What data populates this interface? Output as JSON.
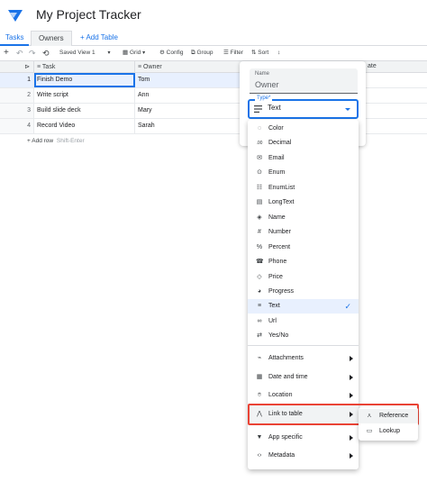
{
  "app": {
    "title": "My Project Tracker",
    "accent": "#1a73e8"
  },
  "tabs": [
    {
      "label": "Tasks"
    },
    {
      "label": "Owners"
    },
    {
      "label": "+ Add Table"
    }
  ],
  "toolbar": {
    "saved_view": "Saved View 1",
    "grid": "Grid",
    "config": "Config",
    "group": "Group",
    "filter": "Filter",
    "sort": "Sort"
  },
  "grid": {
    "columns": [
      "Task",
      "Owner"
    ],
    "rows": [
      {
        "num": "1",
        "task": "Finish Demo",
        "owner": "Tom"
      },
      {
        "num": "2",
        "task": "Write script",
        "owner": "Ann"
      },
      {
        "num": "3",
        "task": "Build slide deck",
        "owner": "Mary"
      },
      {
        "num": "4",
        "task": "Record Video",
        "owner": "Sarah"
      }
    ],
    "add_row": "Add row",
    "add_row_hint": "Shift-Enter",
    "partial_column": "ate"
  },
  "column_editor": {
    "name_label": "Name",
    "name_value": "Owner",
    "type_label": "Type*",
    "type_value": "Text"
  },
  "type_menu": {
    "items": [
      {
        "label": "Color",
        "icon": "palette-icon"
      },
      {
        "label": "Decimal",
        "icon": "decimal-icon"
      },
      {
        "label": "Email",
        "icon": "email-icon"
      },
      {
        "label": "Enum",
        "icon": "enum-icon"
      },
      {
        "label": "EnumList",
        "icon": "enum-list-icon"
      },
      {
        "label": "LongText",
        "icon": "long-text-icon"
      },
      {
        "label": "Name",
        "icon": "name-icon"
      },
      {
        "label": "Number",
        "icon": "number-icon"
      },
      {
        "label": "Percent",
        "icon": "percent-icon"
      },
      {
        "label": "Phone",
        "icon": "phone-icon"
      },
      {
        "label": "Price",
        "icon": "price-icon"
      },
      {
        "label": "Progress",
        "icon": "progress-icon"
      },
      {
        "label": "Text",
        "icon": "text-icon",
        "selected": true
      },
      {
        "label": "Url",
        "icon": "link-icon"
      },
      {
        "label": "Yes/No",
        "icon": "yes-no-icon"
      }
    ],
    "groups": [
      {
        "label": "Attachments",
        "icon": "attachment-icon"
      },
      {
        "label": "Date and time",
        "icon": "calendar-icon"
      },
      {
        "label": "Location",
        "icon": "location-icon"
      },
      {
        "label": "Link to table",
        "icon": "link-table-icon"
      },
      {
        "label": "App specific",
        "icon": "app-specific-icon"
      },
      {
        "label": "Metadata",
        "icon": "metadata-icon"
      }
    ]
  },
  "link_submenu": {
    "items": [
      {
        "label": "Reference",
        "icon": "reference-icon"
      },
      {
        "label": "Lookup",
        "icon": "lookup-icon"
      }
    ]
  },
  "colors": {
    "highlight": "#ea4335",
    "selected_row": "#e8f0fe"
  }
}
